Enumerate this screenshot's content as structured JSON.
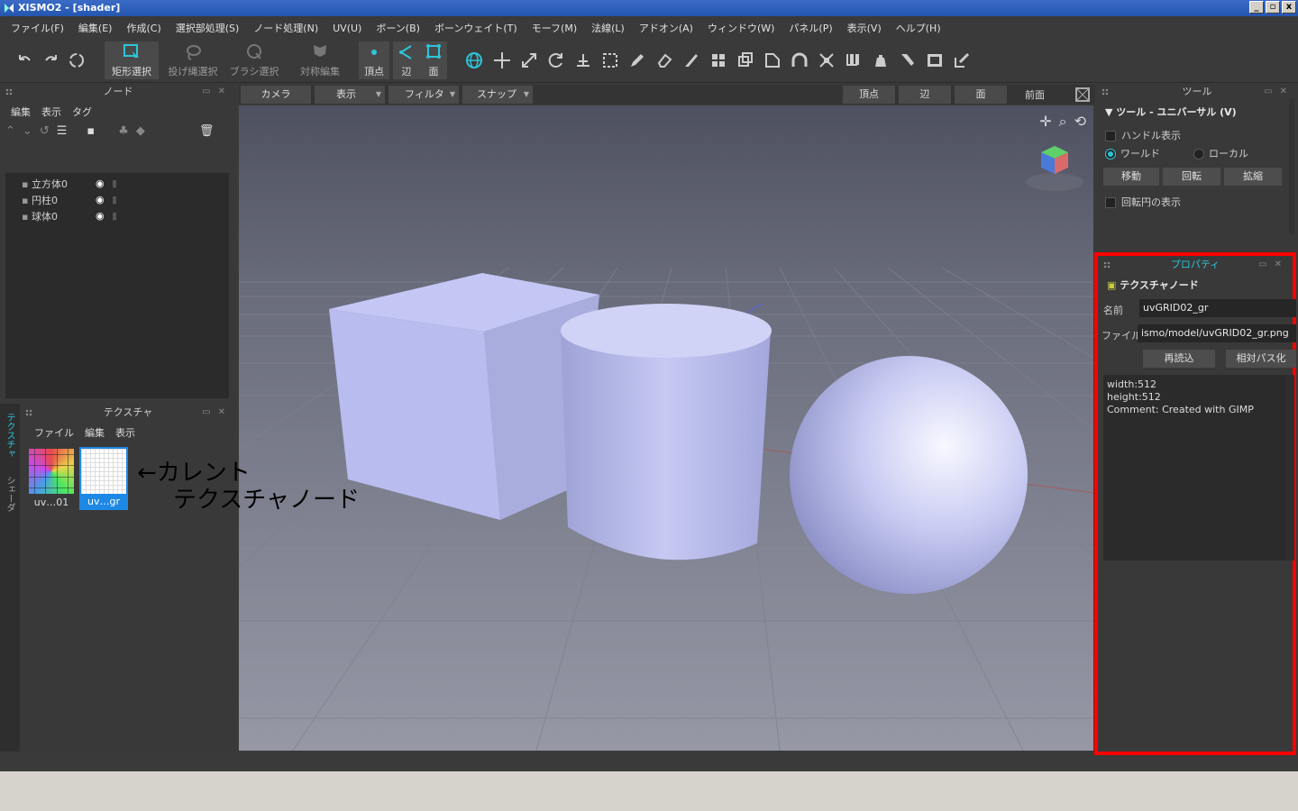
{
  "window": {
    "title": "XISMO2 - [shader]",
    "controls": [
      "_",
      "▫",
      "x"
    ]
  },
  "menu": [
    "ファイル(F)",
    "編集(E)",
    "作成(C)",
    "選択部処理(S)",
    "ノード処理(N)",
    "UV(U)",
    "ボーン(B)",
    "ボーンウェイト(T)",
    "モーフ(M)",
    "法線(L)",
    "アドオン(A)",
    "ウィンドウ(W)",
    "パネル(P)",
    "表示(V)",
    "ヘルプ(H)"
  ],
  "toolbar": {
    "rect_select": "矩形選択",
    "lasso_select": "投げ縄選択",
    "brush_select": "ブラシ選択",
    "sym_edit": "対称編集",
    "vertex": "頂点",
    "edge": "辺",
    "face": "面"
  },
  "node_panel": {
    "title": "ノード",
    "menu": [
      "編集",
      "表示",
      "タグ"
    ],
    "items": [
      {
        "label": "立方体0"
      },
      {
        "label": "円柱0"
      },
      {
        "label": "球体0"
      }
    ]
  },
  "texture_panel": {
    "title": "テクスチャ",
    "menu": [
      "ファイル",
      "編集",
      "表示"
    ],
    "side_tabs": [
      "テクスチャ",
      "シェーダ"
    ],
    "thumbs": [
      {
        "label": "uv…01",
        "current": false
      },
      {
        "label": "uv…gr",
        "current": true
      }
    ]
  },
  "annotation": {
    "line1": "←カレント",
    "line2": "テクスチャノード"
  },
  "viewport_bar": {
    "camera": "カメラ",
    "display": "表示",
    "filter": "フィルタ",
    "snap": "スナップ",
    "vertex": "頂点",
    "edge": "辺",
    "face": "面",
    "view": "前面"
  },
  "tool_panel": {
    "title": "ツール",
    "section": "ツール - ユニバーサル (V)",
    "handle_display": "ハンドル表示",
    "world": "ワールド",
    "local": "ローカル",
    "move": "移動",
    "rotate": "回転",
    "scale": "拡縮",
    "rotation_circle": "回転円の表示"
  },
  "property_panel": {
    "title": "プロパティ",
    "node_type": "テクスチャノード",
    "name_label": "名前",
    "name_value": "uvGRID02_gr",
    "file_label": "ファイル",
    "file_value": "ismo/model/uvGRID02_gr.png",
    "reload": "再読込",
    "relative_path": "相対パス化",
    "info": [
      "width:512",
      "height:512",
      "Comment: Created with GIMP"
    ]
  },
  "colors": {
    "accent": "#2ec4d8",
    "highlight_border": "#ff0000",
    "panel_bg": "#393939"
  }
}
